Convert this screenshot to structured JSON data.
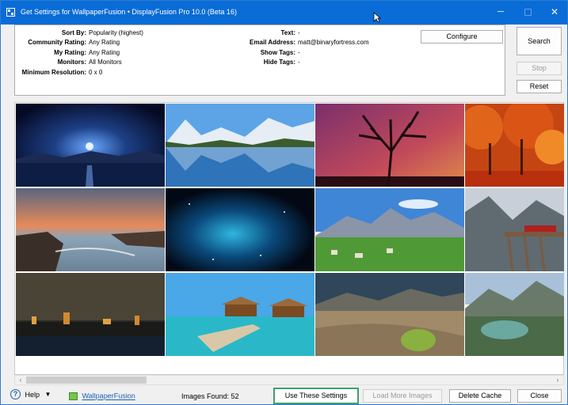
{
  "window": {
    "title": "Get Settings for WallpaperFusion • DisplayFusion Pro 10.0 (Beta 16)",
    "controls": {
      "minimize": "─",
      "maximize": "",
      "close": "✕"
    },
    "accent_color": "#0a6cd6"
  },
  "settings": {
    "left": [
      {
        "label": "Sort By:",
        "value": "Popularity (highest)"
      },
      {
        "label": "Community Rating:",
        "value": "Any Rating"
      },
      {
        "label": "My Rating:",
        "value": "Any Rating"
      },
      {
        "label": "Monitors:",
        "value": "All Monitors"
      },
      {
        "label": "Minimum Resolution:",
        "value": "0 x 0"
      }
    ],
    "right": [
      {
        "label": "Text:",
        "value": "-"
      },
      {
        "label": "Email Address:",
        "value": "matt@binaryfortress.com"
      },
      {
        "label": "Show Tags:",
        "value": "-"
      },
      {
        "label": "Hide Tags:",
        "value": "-"
      }
    ],
    "configure_label": "Configure"
  },
  "side_buttons": {
    "search": "Search",
    "stop": "Stop",
    "reset": "Reset"
  },
  "gallery": {
    "thumbnails": [
      {
        "icon": "night-moon-lake-image"
      },
      {
        "icon": "mountain-lake-reflection-image"
      },
      {
        "icon": "sunset-tree-silhouette-image"
      },
      {
        "icon": "autumn-red-trees-image"
      },
      {
        "icon": "sunset-rocky-coast-image"
      },
      {
        "icon": "blue-nebula-image"
      },
      {
        "icon": "alpine-village-image"
      },
      {
        "icon": "snowy-railway-bridge-image"
      },
      {
        "icon": "city-night-skyline-image"
      },
      {
        "icon": "tropical-water-bungalows-image"
      },
      {
        "icon": "desert-dunes-image"
      },
      {
        "icon": "mountain-glacier-lake-image"
      }
    ]
  },
  "scrollbar": {
    "left_arrow": "‹",
    "right_arrow": "›"
  },
  "footer": {
    "help_label": "Help",
    "help_caret": "▼",
    "help_icon": "?",
    "wallpaperfusion_link": "WallpaperFusion",
    "images_found": "Images Found: 52",
    "use_settings": "Use These Settings",
    "load_more": "Load More Images",
    "delete_cache": "Delete Cache",
    "close": "Close",
    "highlight_color": "#3fa06a"
  }
}
